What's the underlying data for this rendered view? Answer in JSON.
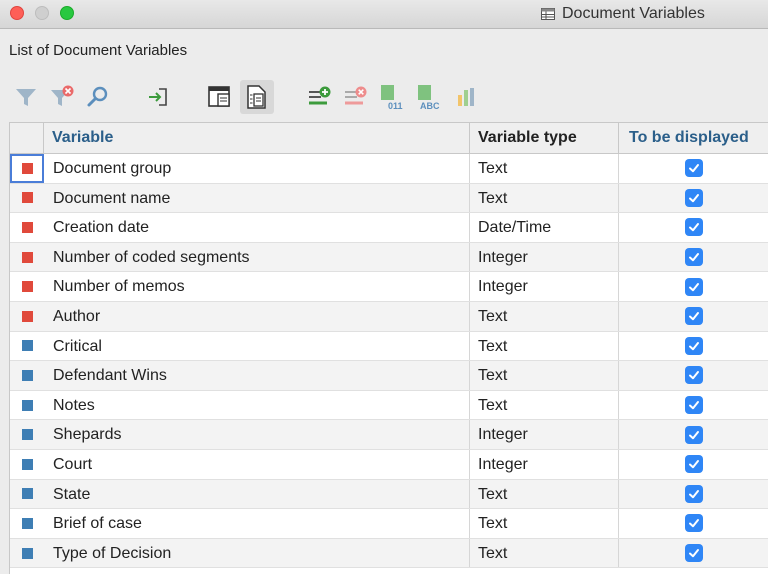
{
  "window": {
    "title": "Document Variables",
    "title_icon": "table-icon"
  },
  "subtitle": "List of Document Variables",
  "toolbar": {
    "buttons": [
      {
        "name": "filter-icon"
      },
      {
        "name": "clear-filter-icon"
      },
      {
        "name": "search-icon"
      },
      {
        "name": "export-icon"
      },
      {
        "name": "show-all-icon"
      },
      {
        "name": "document-variables-icon",
        "active": true
      },
      {
        "name": "add-variable-icon"
      },
      {
        "name": "delete-variable-icon"
      },
      {
        "name": "numeric-variable-icon",
        "label": "011"
      },
      {
        "name": "text-variable-icon",
        "label": "ABC"
      },
      {
        "name": "statistics-icon"
      }
    ]
  },
  "table": {
    "columns": [
      "Variable",
      "Variable type",
      "To be displayed"
    ],
    "rows": [
      {
        "variable": "Document group",
        "type": "Text",
        "displayed": true,
        "marker": "#e0493b"
      },
      {
        "variable": "Document name",
        "type": "Text",
        "displayed": true,
        "marker": "#e0493b"
      },
      {
        "variable": "Creation date",
        "type": "Date/Time",
        "displayed": true,
        "marker": "#e0493b"
      },
      {
        "variable": "Number of coded segments",
        "type": "Integer",
        "displayed": true,
        "marker": "#e0493b"
      },
      {
        "variable": "Number of memos",
        "type": "Integer",
        "displayed": true,
        "marker": "#e0493b"
      },
      {
        "variable": "Author",
        "type": "Text",
        "displayed": true,
        "marker": "#e0493b"
      },
      {
        "variable": "Critical",
        "type": "Text",
        "displayed": true,
        "marker": "#3e7eb4"
      },
      {
        "variable": "Defendant Wins",
        "type": "Text",
        "displayed": true,
        "marker": "#3e7eb4"
      },
      {
        "variable": "Notes",
        "type": "Text",
        "displayed": true,
        "marker": "#3e7eb4"
      },
      {
        "variable": "Shepards",
        "type": "Integer",
        "displayed": true,
        "marker": "#3e7eb4"
      },
      {
        "variable": "Court",
        "type": "Integer",
        "displayed": true,
        "marker": "#3e7eb4"
      },
      {
        "variable": "State",
        "type": "Text",
        "displayed": true,
        "marker": "#3e7eb4"
      },
      {
        "variable": "Brief of case",
        "type": "Text",
        "displayed": true,
        "marker": "#3e7eb4"
      },
      {
        "variable": "Type of Decision",
        "type": "Text",
        "displayed": true,
        "marker": "#3e7eb4"
      }
    ]
  }
}
